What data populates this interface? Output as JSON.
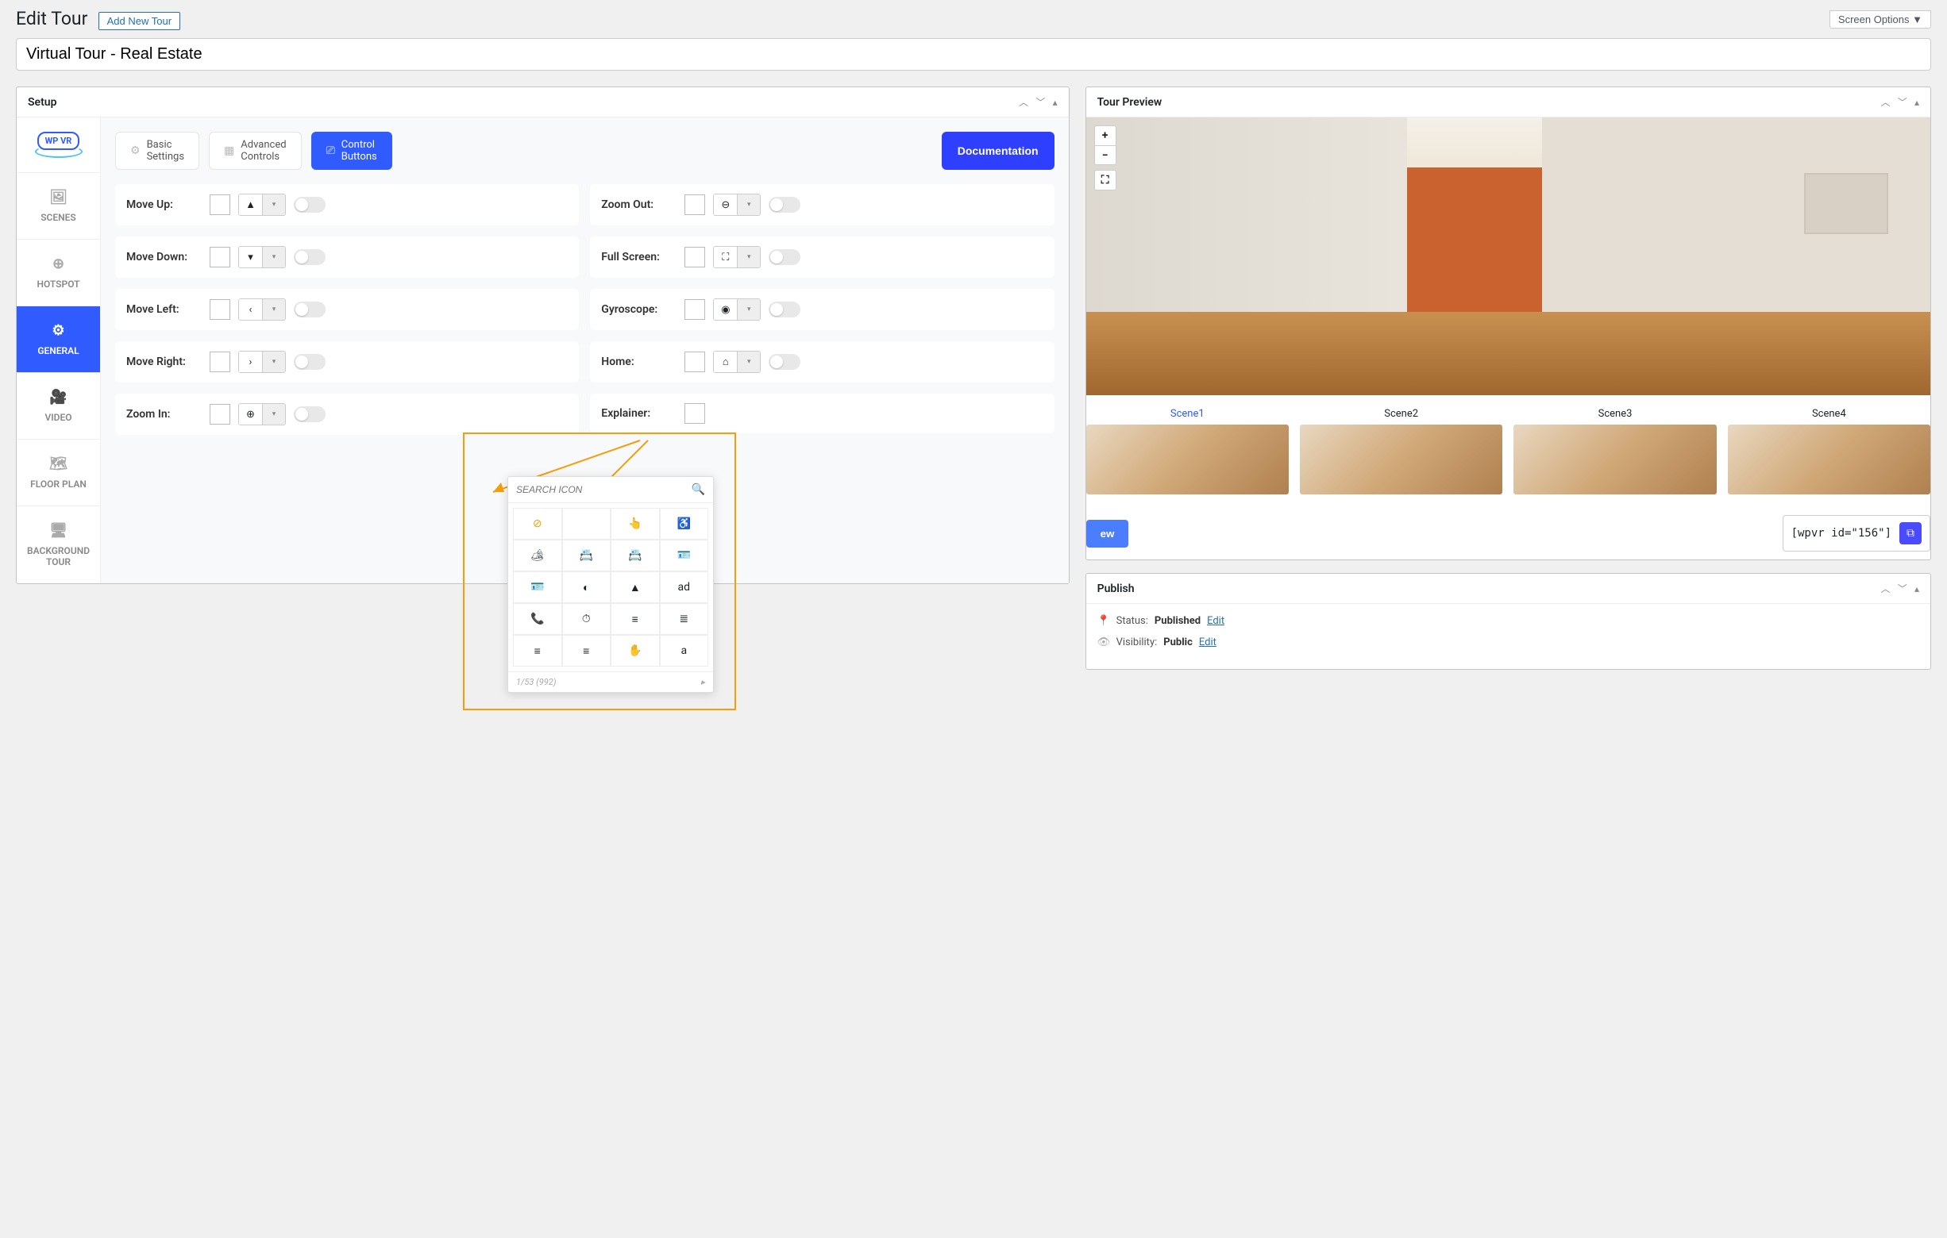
{
  "header": {
    "page_title": "Edit Tour",
    "add_new_label": "Add New Tour",
    "screen_options_label": "Screen Options ▼"
  },
  "title_field": {
    "value": "Virtual Tour - Real Estate"
  },
  "setup_panel": {
    "title": "Setup",
    "logo_text": "WP VR",
    "side_nav": [
      {
        "id": "scenes",
        "label": "SCENES"
      },
      {
        "id": "hotspot",
        "label": "HOTSPOT"
      },
      {
        "id": "general",
        "label": "GENERAL",
        "active": true
      },
      {
        "id": "video",
        "label": "VIDEO"
      },
      {
        "id": "floorplan",
        "label": "FLOOR PLAN"
      },
      {
        "id": "bgtour",
        "label": "BACKGROUND TOUR"
      }
    ],
    "tabs": [
      {
        "id": "basic",
        "label": "Basic\nSettings"
      },
      {
        "id": "advanced",
        "label": "Advanced\nControls"
      },
      {
        "id": "controlbtn",
        "label": "Control\nButtons",
        "active": true
      }
    ],
    "doc_button": "Documentation",
    "controls_left": [
      {
        "id": "moveup",
        "label": "Move Up:",
        "icon": "▲"
      },
      {
        "id": "movedown",
        "label": "Move Down:",
        "icon": "▾"
      },
      {
        "id": "moveleft",
        "label": "Move Left:",
        "icon": "‹"
      },
      {
        "id": "moveright",
        "label": "Move Right:",
        "icon": "›"
      },
      {
        "id": "zoomin",
        "label": "Zoom In:",
        "icon": "⊕"
      }
    ],
    "controls_right": [
      {
        "id": "zoomout",
        "label": "Zoom Out:",
        "icon": "⊖"
      },
      {
        "id": "fullscreen",
        "label": "Full Screen:",
        "icon": "⛶"
      },
      {
        "id": "gyroscope",
        "label": "Gyroscope:",
        "icon": "◉"
      },
      {
        "id": "home",
        "label": "Home:",
        "icon": "⌂"
      },
      {
        "id": "explainer",
        "label": "Explainer:",
        "icon": ""
      }
    ]
  },
  "icon_picker": {
    "placeholder": "SEARCH ICON",
    "footer_text": "1/53 (992)",
    "icons": [
      [
        "⊘",
        "👆",
        "♿"
      ],
      [
        "🏕",
        "📇",
        "📇",
        "🪪"
      ],
      [
        "🪪",
        "◐",
        "▲",
        "ad"
      ],
      [
        "📞",
        "⏱",
        "≡",
        "≣"
      ],
      [
        "≡",
        "≡",
        "✋",
        "a"
      ]
    ]
  },
  "preview_panel": {
    "title": "Tour Preview",
    "zoom_in": "+",
    "zoom_out": "−",
    "fullscreen": "⛶",
    "scenes": [
      "Scene1",
      "Scene2",
      "Scene3",
      "Scene4"
    ],
    "preview_button": "ew",
    "shortcode": "[wpvr id=\"156\"]"
  },
  "publish_panel": {
    "title": "Publish",
    "status_label": "Status: ",
    "status_value": "Published",
    "visibility_label": "Visibility: ",
    "visibility_value": "Public",
    "edit_link": "Edit"
  }
}
